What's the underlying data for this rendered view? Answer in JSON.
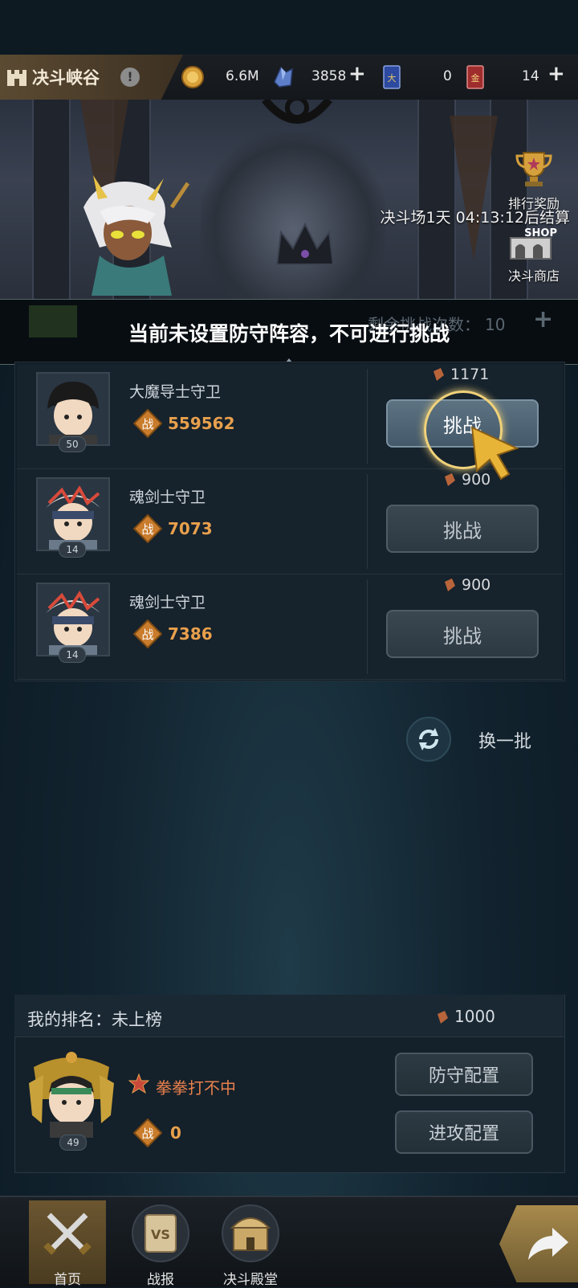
{
  "header": {
    "title": "决斗峡谷",
    "resources": [
      {
        "icon": "gold-coin-icon",
        "value": "6.6M"
      },
      {
        "icon": "crystal-icon",
        "value": "3858"
      },
      {
        "icon": "blue-card-icon",
        "value": "0"
      },
      {
        "icon": "red-card-icon",
        "value": "14"
      }
    ]
  },
  "banner": {
    "countdown": "决斗场1天 04:13:12后结算",
    "rank_reward": "排行奖励",
    "shop": "决斗商店",
    "shop_tag": "SHOP"
  },
  "notice": {
    "text": "当前未设置防守阵容，不可进行挑战",
    "remaining_label": "剩余挑战次数：",
    "remaining_value": "10"
  },
  "opponents": [
    {
      "name": "大魔导士守卫",
      "level": "50",
      "power": "559562",
      "cost": "1171",
      "button": "挑战",
      "zhan": "战"
    },
    {
      "name": "魂剑士守卫",
      "level": "14",
      "power": "7073",
      "cost": "900",
      "button": "挑战",
      "zhan": "战"
    },
    {
      "name": "魂剑士守卫",
      "level": "14",
      "power": "7386",
      "cost": "900",
      "button": "挑战",
      "zhan": "战"
    }
  ],
  "refresh_label": "换一批",
  "my": {
    "rank_label": "我的排名：未上榜",
    "cost": "1000",
    "name": "拳拳打不中",
    "level": "49",
    "power": "0",
    "zhan": "战",
    "defense_btn": "防守配置",
    "attack_btn": "进攻配置"
  },
  "nav": [
    {
      "label": "首页",
      "active": true
    },
    {
      "label": "战报",
      "active": false,
      "badge": "VS"
    },
    {
      "label": "决斗殿堂",
      "active": false
    }
  ],
  "colors": {
    "power": "#e8a04c",
    "name_highlight": "#e8804c",
    "accent_gold": "#a88a4c"
  }
}
